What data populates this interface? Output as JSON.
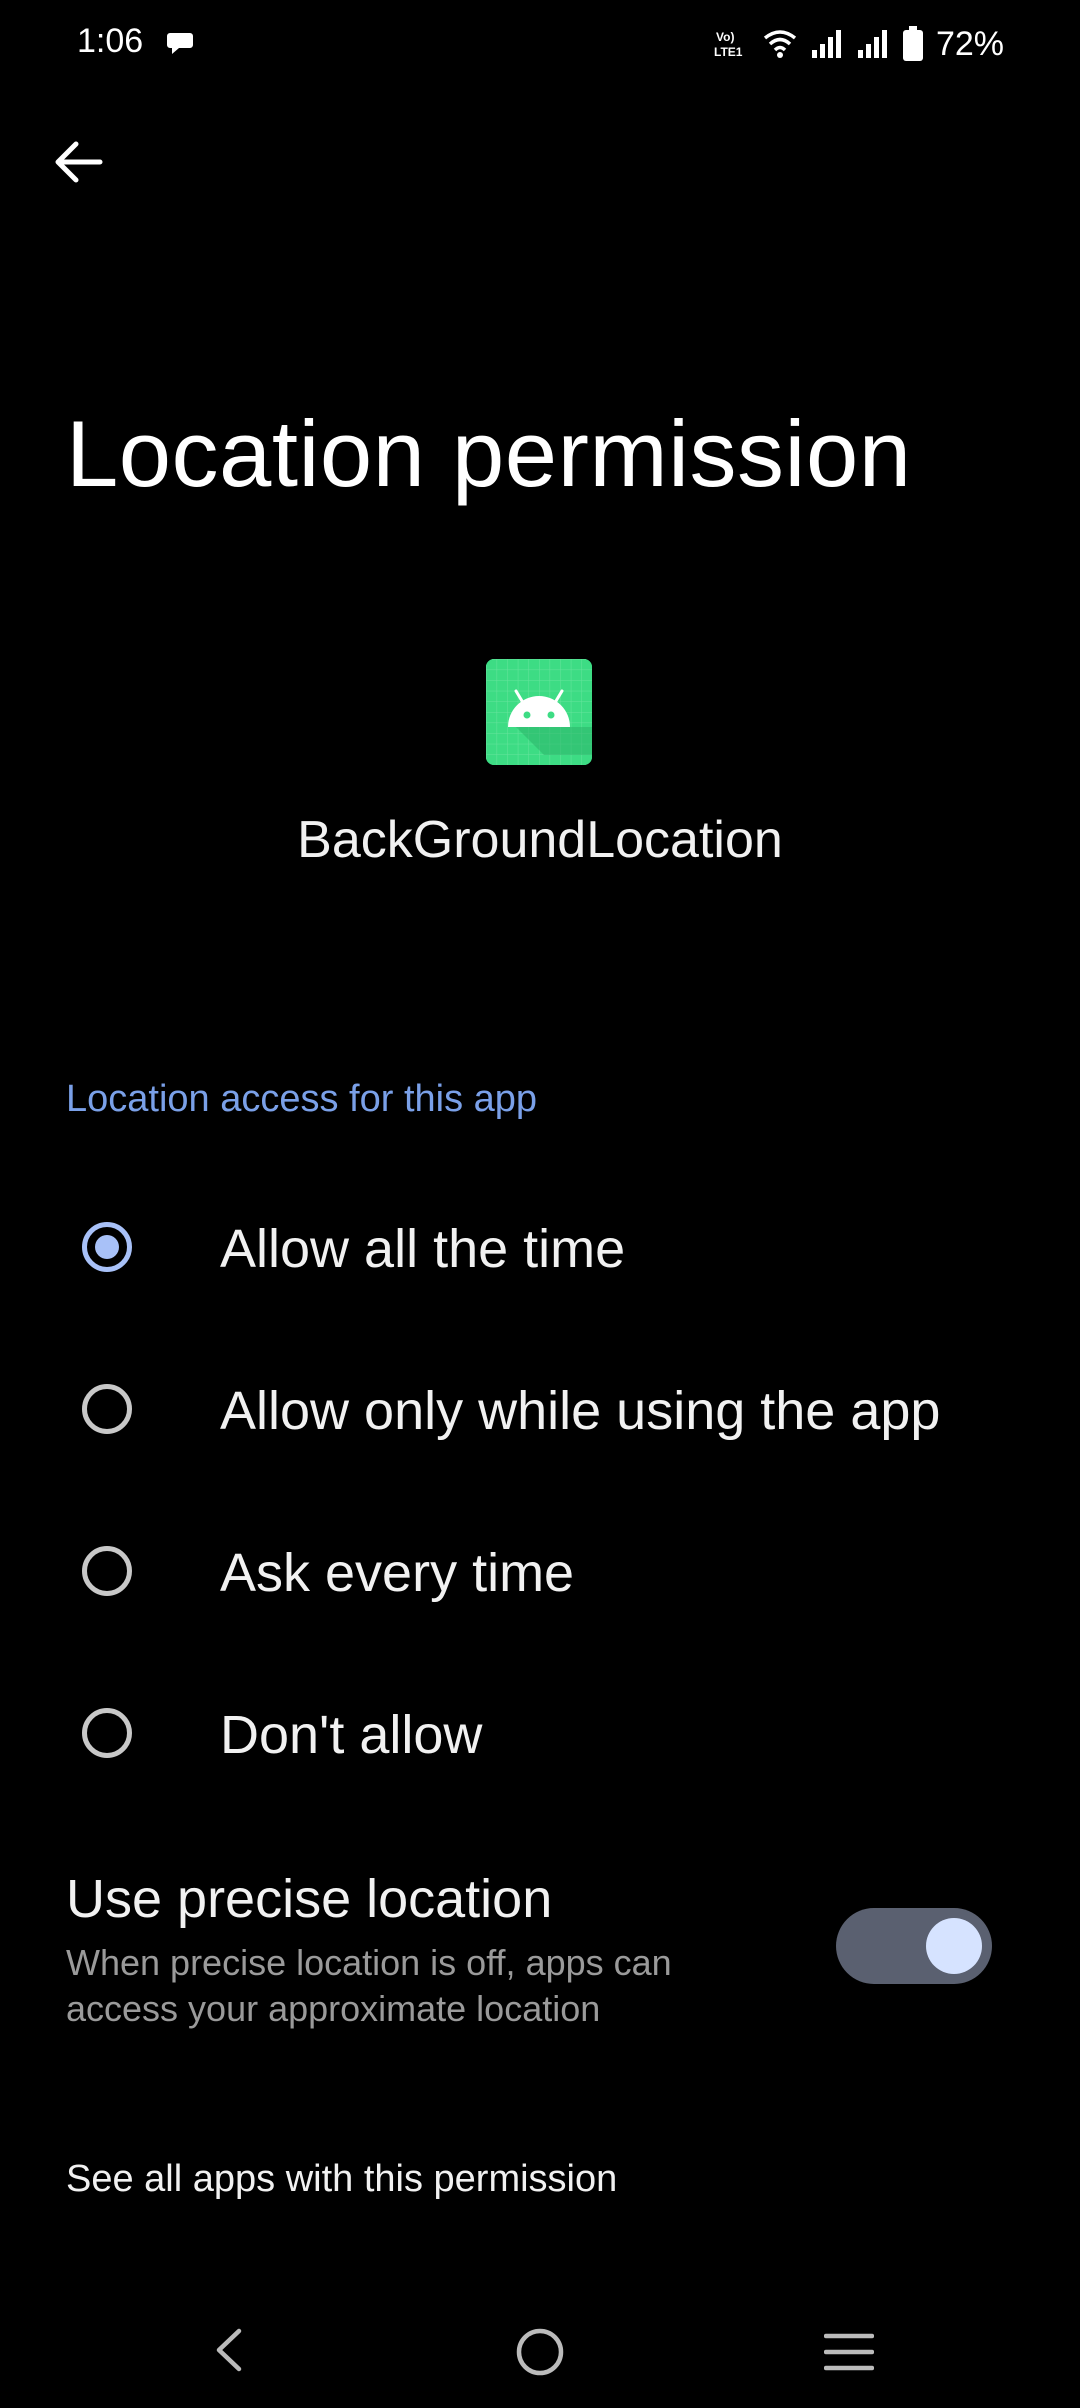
{
  "status_bar": {
    "time": "1:06",
    "battery": "72%",
    "network_badge_top": "Vo)",
    "network_badge_bottom": "LTE1"
  },
  "header": {
    "title": "Location permission"
  },
  "app": {
    "name": "BackGroundLocation",
    "icon": "android-icon"
  },
  "section": {
    "title": "Location access for this app"
  },
  "options": [
    {
      "label": "Allow all the time",
      "selected": true
    },
    {
      "label": "Allow only while using the app",
      "selected": false
    },
    {
      "label": "Ask every time",
      "selected": false
    },
    {
      "label": "Don't allow",
      "selected": false
    }
  ],
  "precise_location": {
    "title": "Use precise location",
    "subtitle": "When precise location is off, apps can access your approximate location",
    "enabled": true
  },
  "footer_link": {
    "label": "See all apps with this permission"
  },
  "colors": {
    "accent": "#7aa0e8",
    "radio_selected": "#a8c1f8",
    "app_icon_bg": "#3ddc84",
    "toggle_track": "#5a6070",
    "toggle_knob": "#d6e3ff"
  }
}
